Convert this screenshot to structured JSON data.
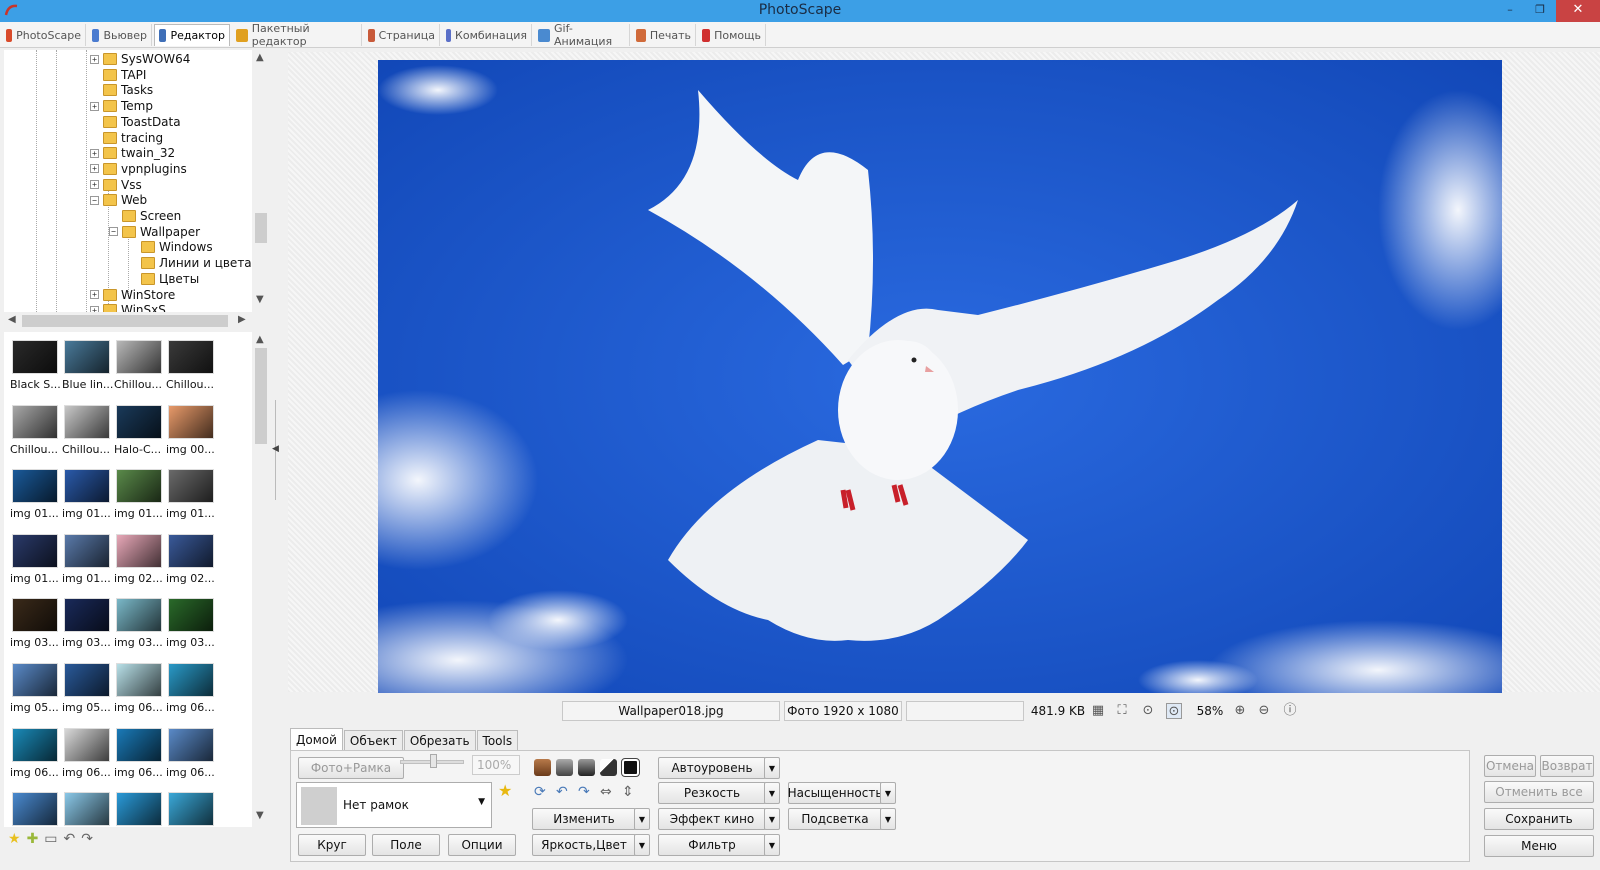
{
  "window": {
    "title": "PhotoScape",
    "minimize": "–",
    "restore": "❐",
    "close": "✕"
  },
  "tabs": [
    {
      "label": "PhotoScape",
      "color": "#d94b2b"
    },
    {
      "label": "Вьювер",
      "color": "#4a7bd0"
    },
    {
      "label": "Редактор",
      "color": "#3f6fb8",
      "active": true
    },
    {
      "label": "Пакетный редактор",
      "color": "#e0a020"
    },
    {
      "label": "Страница",
      "color": "#c85a3a"
    },
    {
      "label": "Комбинация",
      "color": "#5a6fc8"
    },
    {
      "label": "Gif-Анимация",
      "color": "#4a8ad0"
    },
    {
      "label": "Печать",
      "color": "#d06a3a"
    },
    {
      "label": "Помощь",
      "color": "#d03030"
    }
  ],
  "tree": {
    "items": [
      {
        "label": "SysWOW64",
        "expander": "+"
      },
      {
        "label": "TAPI",
        "expander": ""
      },
      {
        "label": "Tasks",
        "expander": ""
      },
      {
        "label": "Temp",
        "expander": "+"
      },
      {
        "label": "ToastData",
        "expander": ""
      },
      {
        "label": "tracing",
        "expander": ""
      },
      {
        "label": "twain_32",
        "expander": "+"
      },
      {
        "label": "vpnplugins",
        "expander": "+"
      },
      {
        "label": "Vss",
        "expander": "+"
      },
      {
        "label": "Web",
        "expander": "−"
      },
      {
        "label": "Screen",
        "expander": ""
      },
      {
        "label": "Wallpaper",
        "expander": "−"
      },
      {
        "label": "Windows",
        "expander": ""
      },
      {
        "label": "Линии и цвета",
        "expander": ""
      },
      {
        "label": "Цветы",
        "expander": ""
      },
      {
        "label": "WinStore",
        "expander": "+"
      },
      {
        "label": "WinSxS",
        "expander": "+"
      }
    ]
  },
  "thumbnails": [
    {
      "label": "Black S...",
      "color": "#2a2a2a"
    },
    {
      "label": "Blue lin...",
      "color": "#4a7a9a"
    },
    {
      "label": "Chillou...",
      "color": "#b8b8b8"
    },
    {
      "label": "Chillou...",
      "color": "#3a3a3a"
    },
    {
      "label": "Chillou...",
      "color": "#a8a8a8"
    },
    {
      "label": "Chillou...",
      "color": "#c8c8c8"
    },
    {
      "label": "Halo-C...",
      "color": "#1a3a5a"
    },
    {
      "label": "img 00...",
      "color": "#e89a6a"
    },
    {
      "label": "img 01...",
      "color": "#1a5a9a"
    },
    {
      "label": "img 01...",
      "color": "#2a5aaa"
    },
    {
      "label": "img 01...",
      "color": "#5a8a4a"
    },
    {
      "label": "img 01...",
      "color": "#6a6a6a"
    },
    {
      "label": "img 01...",
      "color": "#2a3a6a"
    },
    {
      "label": "img 01...",
      "color": "#5a7aaa"
    },
    {
      "label": "img 02...",
      "color": "#e8a8b8"
    },
    {
      "label": "img 02...",
      "color": "#3a5a9a"
    },
    {
      "label": "img 03...",
      "color": "#3a2a1a"
    },
    {
      "label": "img 03...",
      "color": "#1a2a5a"
    },
    {
      "label": "img 03...",
      "color": "#7ab8c8"
    },
    {
      "label": "img 03...",
      "color": "#2a6a2a"
    },
    {
      "label": "img 05...",
      "color": "#5a8ac8"
    },
    {
      "label": "img 05...",
      "color": "#2a5a9a"
    },
    {
      "label": "img 06...",
      "color": "#b8e0e8"
    },
    {
      "label": "img 06...",
      "color": "#2a9ac8"
    },
    {
      "label": "img 06...",
      "color": "#1a8ab8"
    },
    {
      "label": "img 06...",
      "color": "#d8d8d8"
    },
    {
      "label": "img 06...",
      "color": "#1a7ab8"
    },
    {
      "label": "img 06...",
      "color": "#5a8ac8"
    },
    {
      "label": "",
      "color": "#4a8ad0"
    },
    {
      "label": "",
      "color": "#8ac8e8"
    },
    {
      "label": "",
      "color": "#2a9ad8"
    },
    {
      "label": "",
      "color": "#3aa8d8"
    }
  ],
  "status": {
    "filename": "Wallpaper018.jpg",
    "dimensions": "Фото 1920 x 1080",
    "empty": "",
    "filesize": "481.9 KB",
    "zoom": "58%"
  },
  "edit_tabs": [
    "Домой",
    "Объект",
    "Обрезать",
    "Tools"
  ],
  "home": {
    "photo_frame_label": "Фото+Рамка",
    "frame_percent": "100%",
    "frame_value": "Нет рамок",
    "circle": "Круг",
    "margin": "Поле",
    "options": "Опции",
    "resize": "Изменить",
    "brightness": "Яркость,Цвет",
    "autolevel": "Автоуровень",
    "sharpen": "Резкость",
    "film_effect": "Эффект кино",
    "filter": "Фильтр",
    "saturation": "Насыщенность",
    "backlight": "Подсветка"
  },
  "actions": {
    "undo": "Отмена",
    "redo": "Возврат",
    "undo_all": "Отменить все",
    "save": "Сохранить",
    "menu": "Меню"
  },
  "colors": {
    "titlebar": "#3c9fe6",
    "sky": "#1c5bd0",
    "close": "#c94343"
  }
}
